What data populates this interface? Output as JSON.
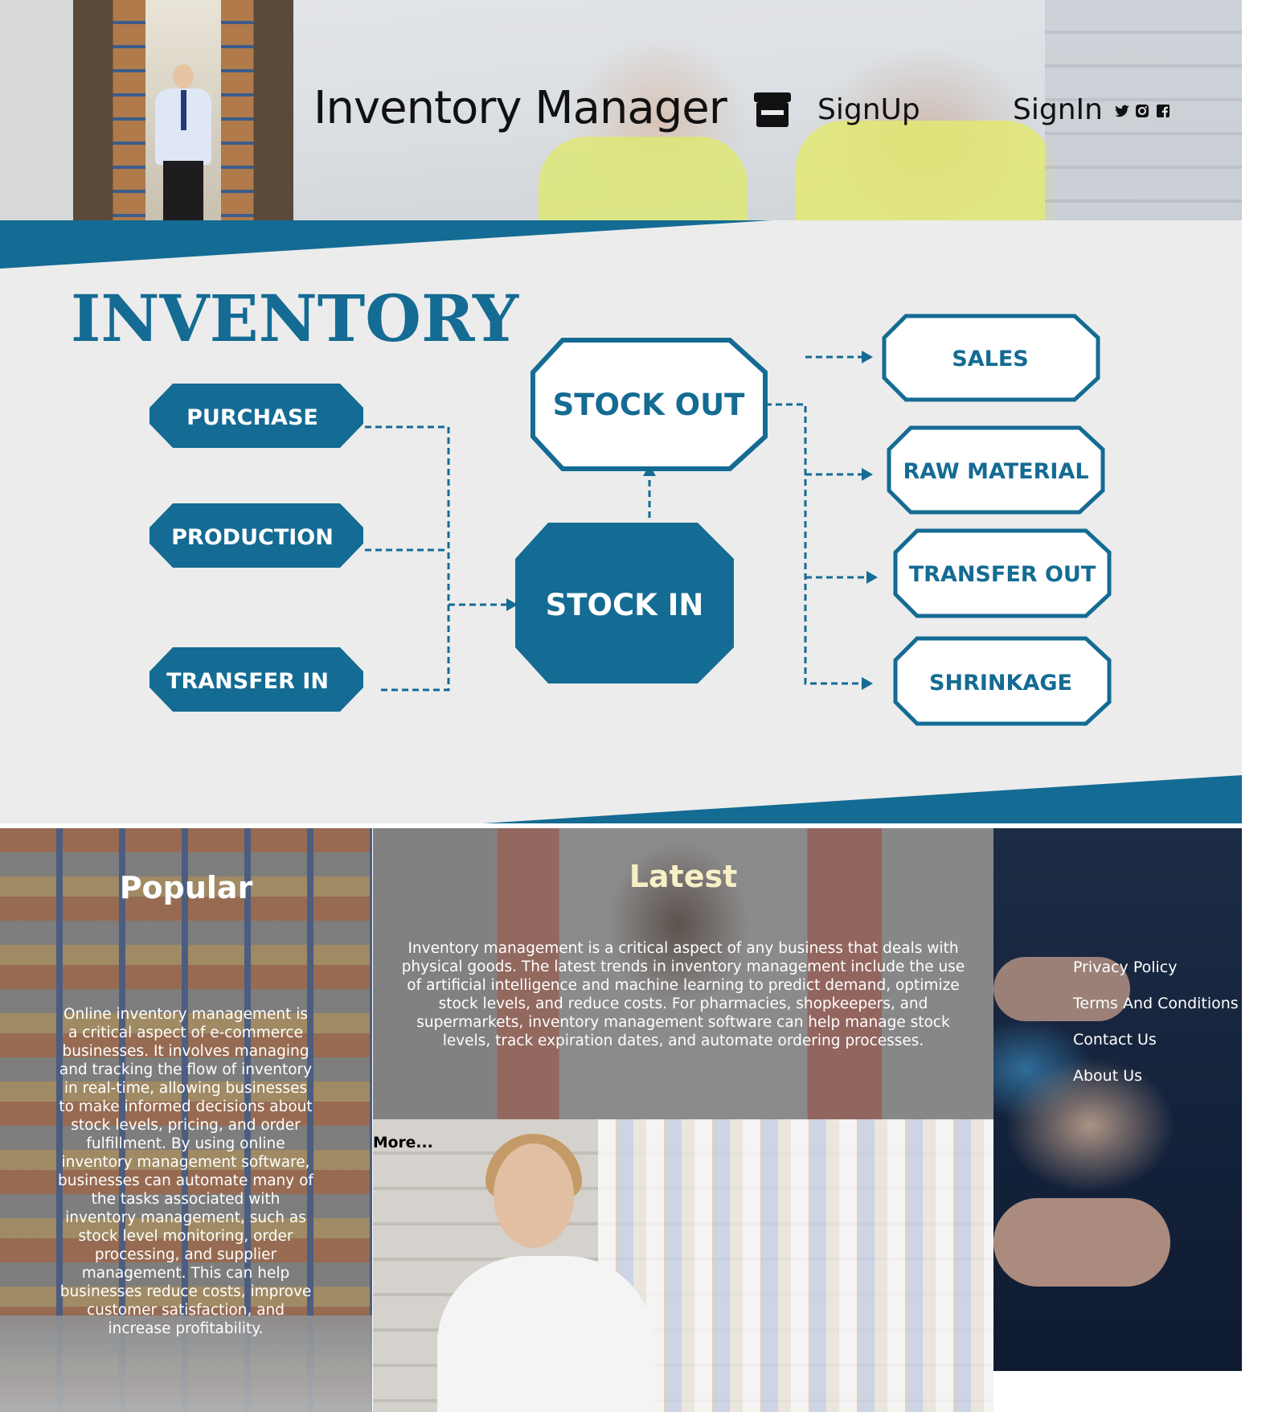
{
  "header": {
    "title": "Inventory Manager",
    "nav": {
      "signup": "SignUp",
      "signin": "SignIn"
    },
    "social_icons": [
      "twitter-icon",
      "instagram-icon",
      "facebook-icon"
    ]
  },
  "infographic": {
    "title": "INVENTORY",
    "inputs": [
      "PURCHASE",
      "PRODUCTION",
      "TRANSFER IN"
    ],
    "center_in": "STOCK IN",
    "center_out": "STOCK OUT",
    "outputs": [
      "SALES",
      "RAW MATERIAL",
      "TRANSFER OUT",
      "SHRINKAGE"
    ],
    "colors": {
      "primary": "#146b93",
      "background": "#ececec"
    }
  },
  "popular": {
    "heading": "Popular",
    "text": "Online inventory management is a critical aspect of e-commerce businesses. It involves managing and tracking the flow of inventory in real-time, allowing businesses to make informed decisions about stock levels, pricing, and order fulfillment. By using online inventory management software, businesses can automate many of the tasks associated with inventory management, such as stock level monitoring, order processing, and supplier management. This can help businesses reduce costs, improve customer satisfaction, and increase profitability."
  },
  "latest": {
    "heading": "Latest",
    "text": "Inventory management is a critical aspect of any business that deals with physical goods. The latest trends in inventory management include the use of artificial intelligence and machine learning to predict demand, optimize stock levels, and reduce costs. For pharmacies, shopkeepers, and supermarkets, inventory management software can help manage stock levels, track expiration dates, and automate ordering processes."
  },
  "more": {
    "heading": "More..."
  },
  "footer": {
    "links": [
      "Privacy Policy",
      "Terms And Conditions",
      "Contact Us",
      "About Us"
    ]
  }
}
